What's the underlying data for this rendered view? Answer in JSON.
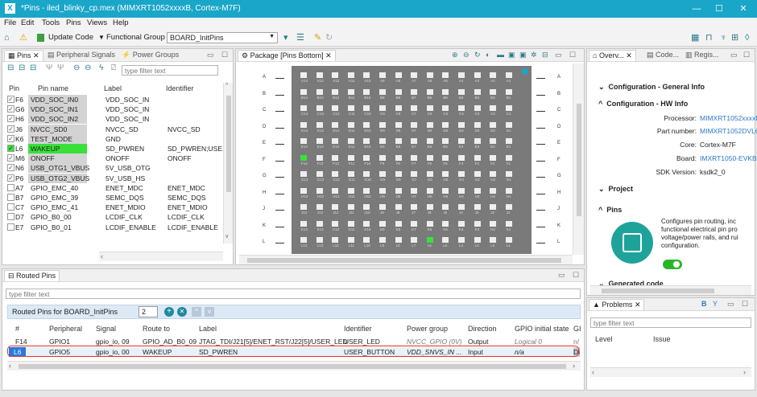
{
  "window": {
    "title": "*Pins - iled_blinky_cp.mex (MIMXRT1052xxxxB, Cortex-M7F)",
    "app_icon_letter": "X"
  },
  "window_controls": {
    "minimize": "—",
    "maximize": "☐",
    "close": "✕"
  },
  "menu": [
    "File",
    "Edit",
    "Tools",
    "Pins",
    "Views",
    "Help"
  ],
  "toolbar": {
    "update_code": "Update Code",
    "functional_group_label": "Functional Group",
    "functional_group_value": "BOARD_InitPins"
  },
  "pins_panel": {
    "tabs": [
      "Pins",
      "Peripheral Signals",
      "Power Groups"
    ],
    "filter_placeholder": "type filter text",
    "columns": [
      "Pin",
      "Pin name",
      "Label",
      "Identifier"
    ],
    "rows": [
      {
        "pin": "F6",
        "name": "VDD_SOC_IN0",
        "label": "VDD_SOC_IN",
        "identifier": "",
        "checked": true,
        "style": "grey"
      },
      {
        "pin": "G6",
        "name": "VDD_SOC_IN1",
        "label": "VDD_SOC_IN",
        "identifier": "",
        "checked": true,
        "style": "grey"
      },
      {
        "pin": "H6",
        "name": "VDD_SOC_IN2",
        "label": "VDD_SOC_IN",
        "identifier": "",
        "checked": true,
        "style": "grey"
      },
      {
        "pin": "J6",
        "name": "NVCC_SD0",
        "label": "NVCC_SD",
        "identifier": "NVCC_SD",
        "checked": true,
        "style": "grey"
      },
      {
        "pin": "K6",
        "name": "TEST_MODE",
        "label": "GND",
        "identifier": "",
        "checked": true,
        "style": "grey"
      },
      {
        "pin": "L6",
        "name": "WAKEUP",
        "label": "SD_PWREN",
        "identifier": "SD_PWREN;USE...",
        "checked": true,
        "style": "green"
      },
      {
        "pin": "M6",
        "name": "ONOFF",
        "label": "ONOFF",
        "identifier": "ONOFF",
        "checked": true,
        "style": "grey"
      },
      {
        "pin": "N6",
        "name": "USB_OTG1_VBUS",
        "label": "5V_USB_OTG",
        "identifier": "",
        "checked": true,
        "style": "grey"
      },
      {
        "pin": "P6",
        "name": "USB_OTG2_VBUS",
        "label": "5V_USB_HS",
        "identifier": "",
        "checked": true,
        "style": "grey"
      },
      {
        "pin": "A7",
        "name": "GPIO_EMC_40",
        "label": "ENET_MDC",
        "identifier": "ENET_MDC",
        "checked": false,
        "style": ""
      },
      {
        "pin": "B7",
        "name": "GPIO_EMC_39",
        "label": "SEMC_DQS",
        "identifier": "SEMC_DQS",
        "checked": false,
        "style": ""
      },
      {
        "pin": "C7",
        "name": "GPIO_EMC_41",
        "label": "ENET_MDIO",
        "identifier": "ENET_MDIO",
        "checked": false,
        "style": ""
      },
      {
        "pin": "D7",
        "name": "GPIO_B0_00",
        "label": "LCDIF_CLK",
        "identifier": "LCDIF_CLK",
        "checked": false,
        "style": ""
      },
      {
        "pin": "E7",
        "name": "GPIO_B0_01",
        "label": "LCDIF_ENABLE",
        "identifier": "LCDIF_ENABLE",
        "checked": false,
        "style": ""
      }
    ]
  },
  "package_panel": {
    "tab": "Package [Pins Bottom]",
    "rows": [
      "A",
      "B",
      "C",
      "D",
      "E",
      "F",
      "G",
      "H",
      "J",
      "K",
      "L"
    ],
    "cols": [
      "14",
      "13",
      "12",
      "11",
      "10",
      "9",
      "8",
      "7",
      "6",
      "5",
      "4",
      "3",
      "2",
      "1"
    ],
    "highlighted": [
      "F14",
      "L6"
    ]
  },
  "overview_panel": {
    "tabs": [
      "Overv...",
      "Code...",
      "Regis..."
    ],
    "sections": {
      "general": "Configuration - General Info",
      "hw": "Configuration - HW Info",
      "project": "Project",
      "pins": "Pins",
      "generated": "Generated code"
    },
    "hw": {
      "processor_label": "Processor:",
      "processor": "MIMXRT1052xxxxB",
      "part_label": "Part number:",
      "part": "MIMXRT1052DVL6B",
      "core_label": "Core:",
      "core": "Cortex-M7F",
      "board_label": "Board:",
      "board": "IMXRT1050-EVKB",
      "sdk_label": "SDK Version:",
      "sdk": "ksdk2_0"
    },
    "pins_text": [
      "Configures pin routing, inc",
      "functional electrical pin pro",
      "voltage/power rails, and rui",
      "configuration."
    ]
  },
  "routed_panel": {
    "tab": "Routed Pins",
    "filter_placeholder": "type filter text",
    "group_label": "Routed Pins for BOARD_InitPins",
    "count": "2",
    "columns": [
      "#",
      "Peripheral",
      "Signal",
      "Route to",
      "Label",
      "Identifier",
      "Power group",
      "Direction",
      "GPIO initial state",
      "GI"
    ],
    "rows": [
      {
        "num": "F14",
        "peripheral": "GPIO1",
        "signal": "gpio_io, 09",
        "route": "GPIO_AD_B0_09",
        "label": "JTAG_TDI/J21[5]/ENET_RST/J22[5]/USER_LED",
        "identifier": "USER_LED",
        "power": "NVCC_GPIO (0V)",
        "direction": "Output",
        "init": "Logical 0",
        "gi": "n/"
      },
      {
        "num": "L6",
        "peripheral": "GPIO5",
        "signal": "gpio_io, 00",
        "route": "WAKEUP",
        "label": "SD_PWREN",
        "identifier": "USER_BUTTON",
        "power": "VDD_SNVS_IN ...",
        "direction": "Input",
        "init": "n/a",
        "gi": "Di"
      }
    ]
  },
  "problems_panel": {
    "tab": "Problems",
    "filter_placeholder": "type filter text",
    "columns": [
      "Level",
      "Issue"
    ]
  },
  "colors": {
    "titlebar": "#1aa6c8",
    "pin_green": "#38e038",
    "link": "#2a78c8",
    "selection_border": "#e03030"
  }
}
